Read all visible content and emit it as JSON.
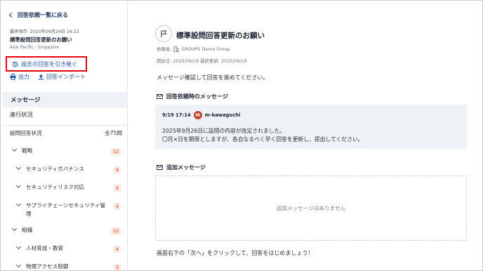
{
  "sidebar": {
    "back_label": "回答依頼一覧に戻る",
    "saved_label": "最終保存: 2025年09月24日 16:23",
    "doc_title": "標準設問回答更新のお願い",
    "region": "Asia Pacific - Singapore",
    "inherit_label": "過去の回答を引き継ぐ",
    "export_label": "出力",
    "import_label": "回答インポート",
    "nav": {
      "message": "メッセージ",
      "progress": "進行状況"
    },
    "question_status": {
      "label": "設問回答状況",
      "total": "全75問"
    },
    "tree": [
      {
        "label": "戦略",
        "count": "12"
      },
      {
        "label": "セキュリティガバナンス",
        "count": "4"
      },
      {
        "label": "セキュリティリスク対応",
        "count": "4"
      },
      {
        "label": "サプライチェーンセキュリティ管理",
        "count": "4"
      },
      {
        "label": "組織",
        "count": "12"
      },
      {
        "label": "人材育成・教育",
        "count": "4"
      },
      {
        "label": "物理アクセス制御",
        "count": "3"
      }
    ]
  },
  "main": {
    "title": "標準設問回答更新のお願い",
    "requester_label": "依頼者:",
    "requester_name": "GROUPS Demo Group",
    "dates": "開始日: 2025/09/19 最終更新: 2025/09/19",
    "intro": "メッセージ確認して回答を進めてください。",
    "request_message_heading": "回答依頼時のメッセージ",
    "message": {
      "time": "9/19 17:14",
      "avatar_initial": "M",
      "author": "m-kawaguchi",
      "line1": "2025年9月26日に設問の内容が改定されました。",
      "line2": "〇月×日を期限としますが、各自なるべく早く回答を更新し、提出してください。"
    },
    "additional_heading": "追加メッセージ",
    "additional_empty": "追加メッセージはありません",
    "bottom_text": "画面右下の「次へ」をクリックして、回答をはじめましょう！"
  },
  "colors": {
    "link": "#2456a6",
    "highlight_border": "#e60012",
    "badge_text": "#d0451b",
    "badge_bg": "#fde7df",
    "avatar": "#c2452d",
    "selected_nav_bg": "#eef2f7"
  },
  "icons": [
    "chevron-left-icon",
    "history-icon",
    "print-icon",
    "upload-icon",
    "flag-icon",
    "building-icon",
    "mail-icon",
    "chevron-down-icon"
  ]
}
